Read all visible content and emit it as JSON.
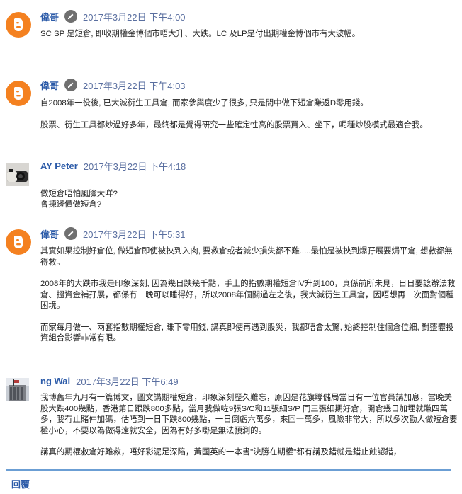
{
  "comments": [
    {
      "author": "偉哥",
      "date": "2017年3月22日 下午4:00",
      "avatar": "blogger-icon",
      "has_edit_icon": true,
      "paragraphs": [
        "SC SP 是短倉, 即收期權金博個市唔大升、大跌。LC 及LP是付出期權金博個市有大波幅。"
      ]
    },
    {
      "author": "偉哥",
      "date": "2017年3月22日 下午4:03",
      "avatar": "blogger-icon",
      "has_edit_icon": true,
      "paragraphs": [
        "自2008年一役後, 已大減衍生工具倉, 而家參與度少了很多, 只是間中做下短倉賺返D零用錢。",
        "股票、衍生工具都炒過好多年，最終都是覺得研究一些確定性高的股票買入、坐下，呢種炒股模式最適合我。"
      ]
    },
    {
      "author": "AY Peter",
      "date": "2017年3月22日 下午4:18",
      "avatar": "user-photo",
      "has_edit_icon": false,
      "paragraphs": [
        "做短倉唔怕風險大咩?\n會揀邊價做短倉?"
      ]
    },
    {
      "author": "偉哥",
      "date": "2017年3月22日 下午5:31",
      "avatar": "blogger-icon",
      "has_edit_icon": true,
      "paragraphs": [
        "其實如果控制好倉位, 做短倉即使被挾到入肉, 要救倉或者減少損失都不難.....最怕是被挾到爆孖展要焗平倉, 想救都無得救。",
        "2008年的大跌市我是印象深刻, 因為幾日跌幾千點，手上的指數期權短倉IV升到100，真係前所未見，日日要諗辦法救倉、搵資金補孖展，都係冇一晚可以睡得好，所以2008年個關過左之後，我大減衍生工具倉，因唔想再一次面對個種困境。",
        "而家每月做一、兩套指數期權短倉, 賺下零用錢, 講真即使再遇到股災，我都唔會太驚, 始終控制住個倉位細, 對整體投資組合影響非常有限。"
      ]
    },
    {
      "author": "ng Wai",
      "date": "2017年3月22日 下午6:49",
      "avatar": "user-photo",
      "has_edit_icon": false,
      "paragraphs": [
        "我博舊年九月有一篇博文，圖文講期權短倉，印象深刻歷久難忘，原因是花旗聯儲局當日有一位官員講加息，當晚美股大跌400幾點，香港第日跟跌800多點，當月我做咗9張S/C和11張細S/P 同三張細期好倉，開倉幾日加埋就賺四萬多，我冇止賭仲加碼，估唔到一日下跌800幾點，一日倒虧六萬多，來回十萬多，風險非常大，所以多次勸人做短倉要極小心，不要以為做得遠就安全，因為有好多嘢是無法預測的。",
        "講真的期權救倉好難救，唔好彩泥足深陷，黃國英的一本書\"決勝在期權\"都有講及錯就是錯止蝕認錯，"
      ]
    }
  ],
  "reply_label": "回覆",
  "colors": {
    "author_link": "#2b5aa8",
    "blogger_orange": "#f48120",
    "divider": "#6b9ed4"
  }
}
